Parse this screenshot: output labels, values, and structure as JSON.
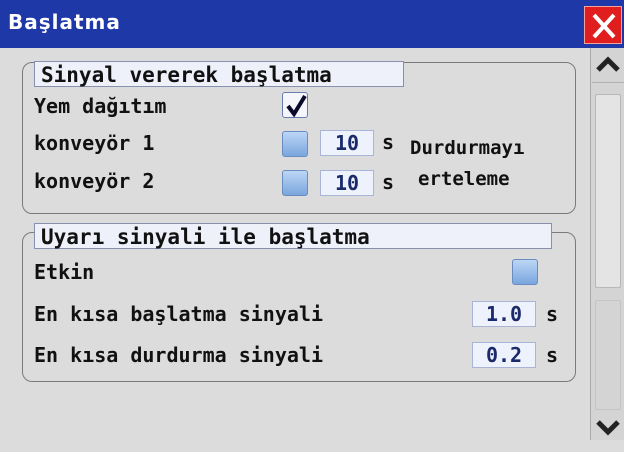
{
  "window": {
    "title": "Başlatma"
  },
  "section1": {
    "title": "Sinyal vererek başlatma",
    "rows": [
      {
        "label": "Yem dağıtım",
        "checked": true
      },
      {
        "label": "konveyör 1",
        "checked": false,
        "value": "10",
        "unit": "s"
      },
      {
        "label": "konveyör 2",
        "checked": false,
        "value": "10",
        "unit": "s"
      }
    ],
    "side_label_1": "Durdurmayı",
    "side_label_2": "erteleme"
  },
  "section2": {
    "title": "Uyarı sinyali ile başlatma",
    "enabled_label": "Etkin",
    "enabled_checked": false,
    "min_start_label": "En kısa başlatma sinyali",
    "min_start_value": "1.0",
    "min_start_unit": "s",
    "min_stop_label": "En kısa durdurma sinyali",
    "min_stop_value": "0.2",
    "min_stop_unit": "s"
  },
  "colors": {
    "titlebar": "#1e38a8",
    "close": "#e01e1e",
    "checkbox": "#8cb4e6"
  },
  "icons": {
    "close": "close-icon",
    "check": "checkmark-icon",
    "up": "chevron-up-icon",
    "down": "chevron-down-icon"
  }
}
